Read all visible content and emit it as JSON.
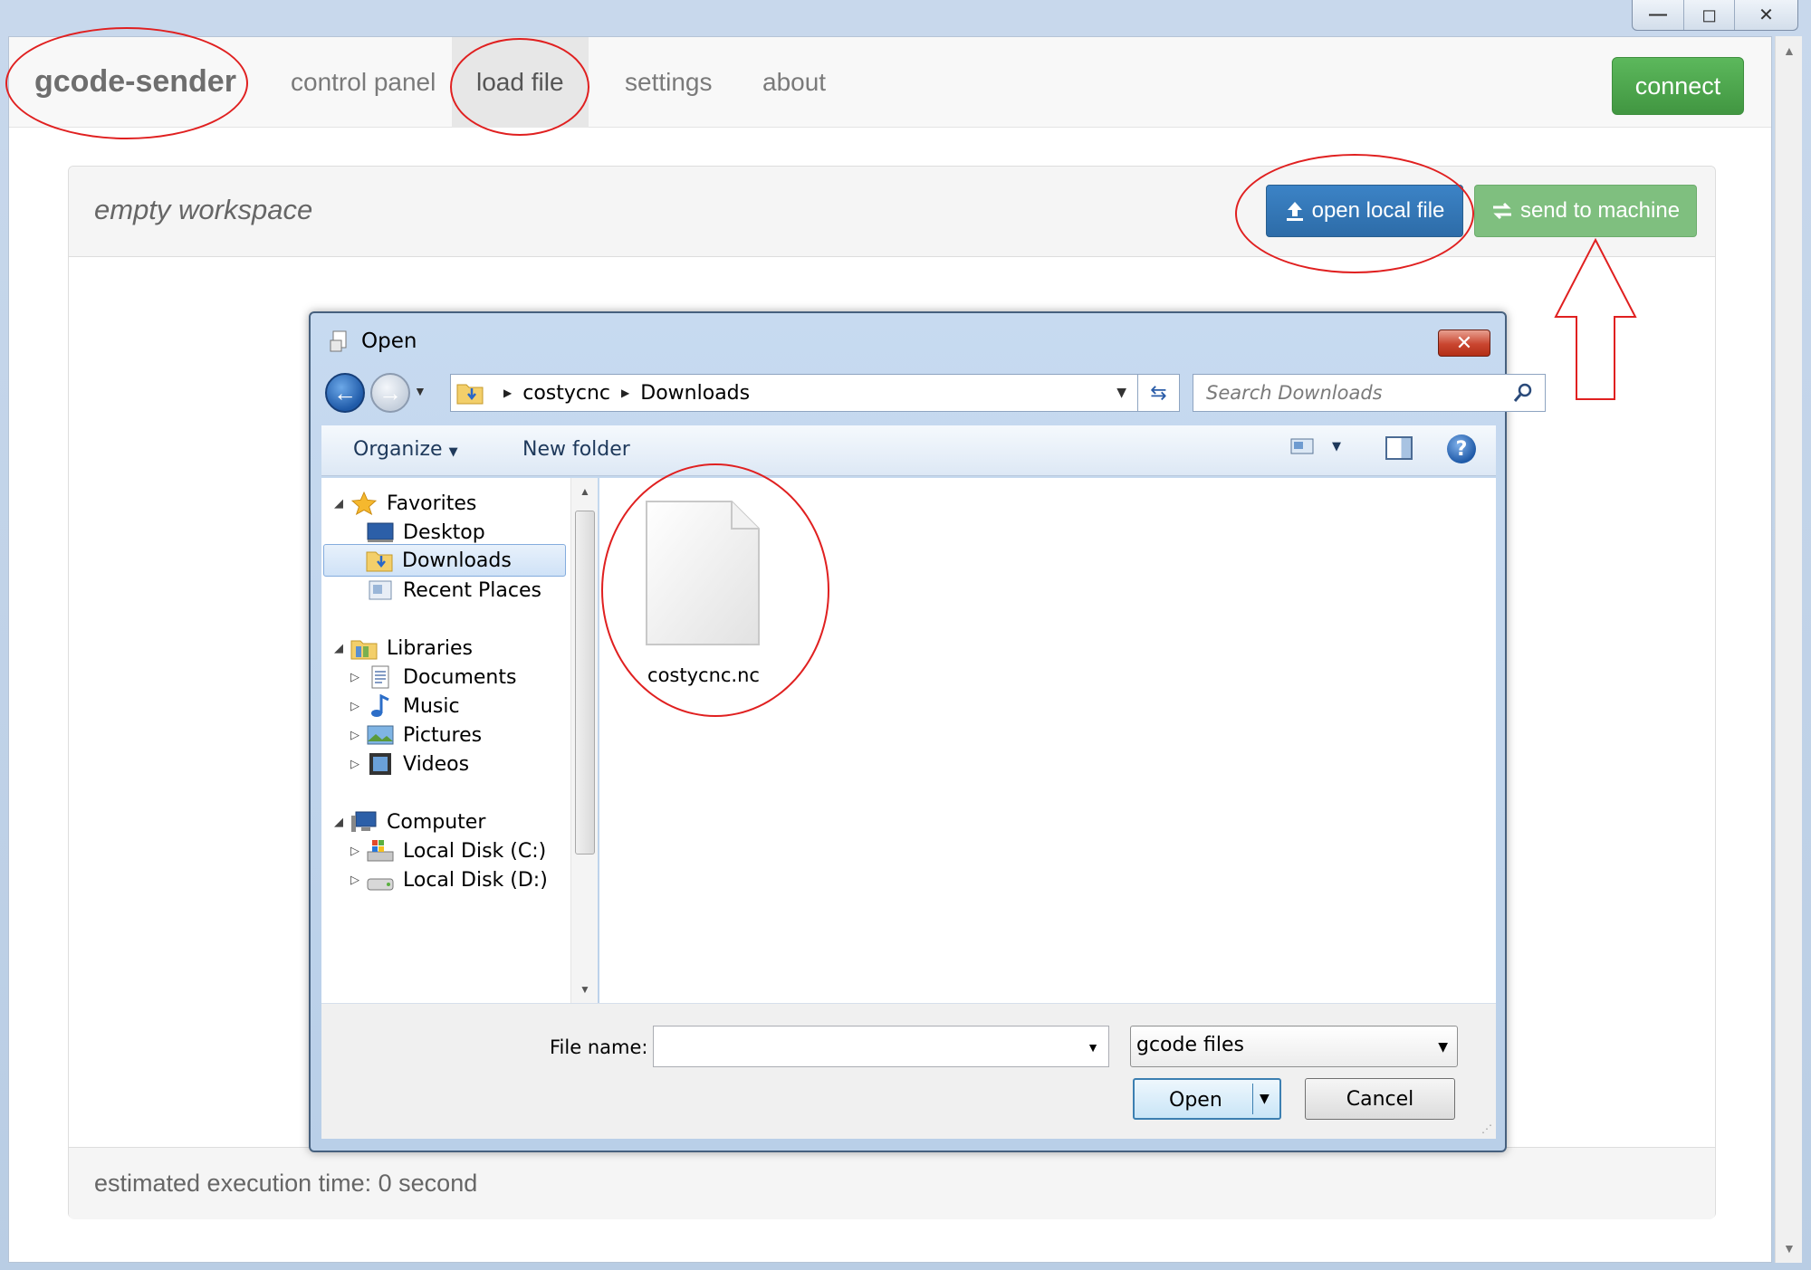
{
  "window": {
    "minimize": "—",
    "maximize": "◻",
    "close": "✕"
  },
  "navbar": {
    "brand": "gcode-sender",
    "items": [
      {
        "label": "control panel"
      },
      {
        "label": "load file"
      },
      {
        "label": "settings"
      },
      {
        "label": "about"
      }
    ],
    "connect_label": "connect"
  },
  "panel": {
    "title": "empty workspace",
    "open_local_label": "open local file",
    "send_label": "send to machine",
    "exec_time": "estimated execution time: 0 second"
  },
  "dialog": {
    "title": "Open",
    "close": "✕",
    "address": {
      "crumbs": [
        "costycnc",
        "Downloads"
      ]
    },
    "search_placeholder": "Search Downloads",
    "toolbar": {
      "organize": "Organize",
      "new_folder": "New folder",
      "help": "?"
    },
    "tree": {
      "favorites": "Favorites",
      "desktop": "Desktop",
      "downloads": "Downloads",
      "recent": "Recent Places",
      "libraries": "Libraries",
      "documents": "Documents",
      "music": "Music",
      "pictures": "Pictures",
      "videos": "Videos",
      "computer": "Computer",
      "disk_c": "Local Disk (C:)",
      "disk_d": "Local Disk (D:)"
    },
    "files": [
      {
        "name": "costycnc.nc"
      }
    ],
    "file_name_label": "File name:",
    "file_name_value": "",
    "filter": "gcode files",
    "open_label": "Open",
    "cancel_label": "Cancel"
  },
  "colors": {
    "connect_green": "#5cb85c",
    "open_blue": "#337ab7",
    "send_green": "#7fbf7f",
    "annotation_red": "#e02020"
  }
}
